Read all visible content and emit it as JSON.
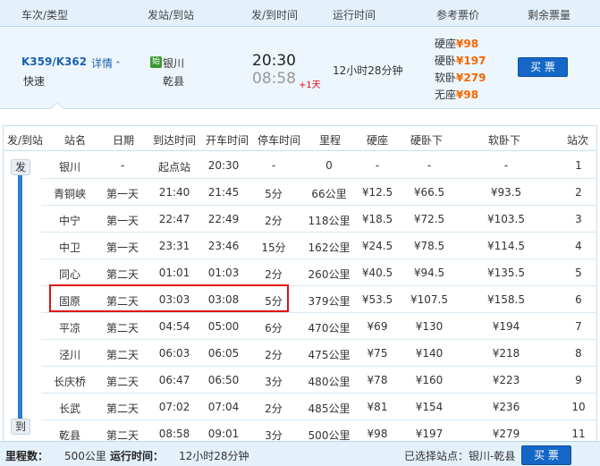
{
  "header": {
    "col_train": "车次/类型",
    "col_station": "发站/到站",
    "col_time": "发/到时间",
    "col_duration": "运行时间",
    "col_price": "参考票价",
    "col_remaining": "剩余票量"
  },
  "train": {
    "number": "K359/K362",
    "detail_label": "详情",
    "type": "快速",
    "start_badge": "始",
    "from_station": "银川",
    "to_station": "乾县",
    "depart_time": "20:30",
    "arrive_time": "08:58",
    "plus_day": "+1天",
    "duration": "12小时28分钟",
    "prices": [
      {
        "seat": "硬座",
        "price": "¥98"
      },
      {
        "seat": "硬卧",
        "price": "¥197"
      },
      {
        "seat": "软卧",
        "price": "¥279"
      },
      {
        "seat": "无座",
        "price": "¥98"
      }
    ],
    "buy_label": "买 票"
  },
  "stops_header": {
    "dir": "发/到站",
    "name": "站名",
    "date": "日期",
    "arrive": "到达时间",
    "depart": "开车时间",
    "stop": "停车时间",
    "mileage": "里程",
    "hard_seat": "硬座",
    "hard_sleeper": "硬卧下",
    "soft_sleeper": "软卧下",
    "order": "站次"
  },
  "stops": [
    {
      "name": "银川",
      "date": "-",
      "arrive": "起点站",
      "depart": "20:30",
      "stop": "-",
      "mileage": "0",
      "hard_seat": "-",
      "hard_sleeper": "-",
      "soft_sleeper": "-",
      "order": "1"
    },
    {
      "name": "青铜峡",
      "date": "第一天",
      "arrive": "21:40",
      "depart": "21:45",
      "stop": "5分",
      "mileage": "66公里",
      "hard_seat": "¥12.5",
      "hard_sleeper": "¥66.5",
      "soft_sleeper": "¥93.5",
      "order": "2"
    },
    {
      "name": "中宁",
      "date": "第一天",
      "arrive": "22:47",
      "depart": "22:49",
      "stop": "2分",
      "mileage": "118公里",
      "hard_seat": "¥18.5",
      "hard_sleeper": "¥72.5",
      "soft_sleeper": "¥103.5",
      "order": "3"
    },
    {
      "name": "中卫",
      "date": "第一天",
      "arrive": "23:31",
      "depart": "23:46",
      "stop": "15分",
      "mileage": "162公里",
      "hard_seat": "¥24.5",
      "hard_sleeper": "¥78.5",
      "soft_sleeper": "¥114.5",
      "order": "4"
    },
    {
      "name": "同心",
      "date": "第二天",
      "arrive": "01:01",
      "depart": "01:03",
      "stop": "2分",
      "mileage": "260公里",
      "hard_seat": "¥40.5",
      "hard_sleeper": "¥94.5",
      "soft_sleeper": "¥135.5",
      "order": "5"
    },
    {
      "name": "固原",
      "date": "第二天",
      "arrive": "03:03",
      "depart": "03:08",
      "stop": "5分",
      "mileage": "379公里",
      "hard_seat": "¥53.5",
      "hard_sleeper": "¥107.5",
      "soft_sleeper": "¥158.5",
      "order": "6"
    },
    {
      "name": "平凉",
      "date": "第二天",
      "arrive": "04:54",
      "depart": "05:00",
      "stop": "6分",
      "mileage": "470公里",
      "hard_seat": "¥69",
      "hard_sleeper": "¥130",
      "soft_sleeper": "¥194",
      "order": "7"
    },
    {
      "name": "泾川",
      "date": "第二天",
      "arrive": "06:03",
      "depart": "06:05",
      "stop": "2分",
      "mileage": "475公里",
      "hard_seat": "¥75",
      "hard_sleeper": "¥140",
      "soft_sleeper": "¥218",
      "order": "8"
    },
    {
      "name": "长庆桥",
      "date": "第二天",
      "arrive": "06:47",
      "depart": "06:50",
      "stop": "3分",
      "mileage": "480公里",
      "hard_seat": "¥78",
      "hard_sleeper": "¥160",
      "soft_sleeper": "¥223",
      "order": "9"
    },
    {
      "name": "长武",
      "date": "第二天",
      "arrive": "07:02",
      "depart": "07:04",
      "stop": "2分",
      "mileage": "485公里",
      "hard_seat": "¥81",
      "hard_sleeper": "¥154",
      "soft_sleeper": "¥236",
      "order": "10"
    },
    {
      "name": "乾县",
      "date": "第二天",
      "arrive": "08:58",
      "depart": "09:01",
      "stop": "3分",
      "mileage": "500公里",
      "hard_seat": "¥98",
      "hard_sleeper": "¥197",
      "soft_sleeper": "¥279",
      "order": "11"
    }
  ],
  "track_labels": {
    "start": "发",
    "end": "到"
  },
  "footer": {
    "mileage_label": "里程数：",
    "mileage_value": "500公里",
    "duration_label": "运行时间：",
    "duration_value": "12小时28分钟",
    "selected_label": "已选择站点：银川-乾县",
    "buy_label": "买 票"
  },
  "colors": {
    "accent": "#1467c7",
    "price": "#f66700",
    "highlight": "#e01010"
  }
}
